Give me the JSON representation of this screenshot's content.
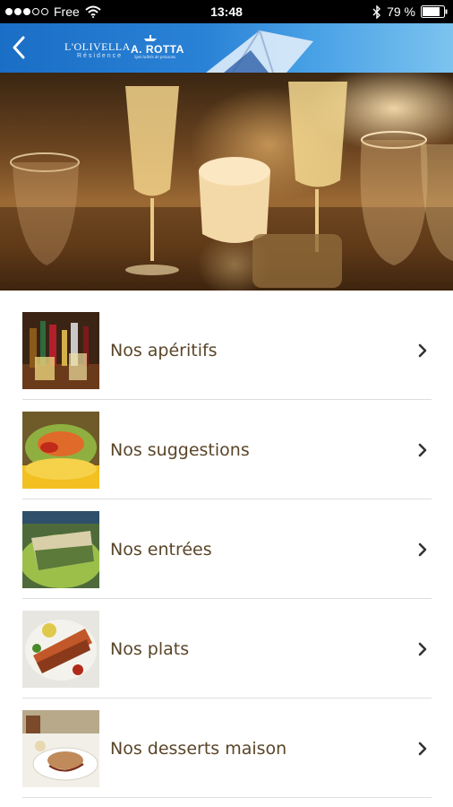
{
  "status_bar": {
    "carrier": "Free",
    "time": "13:48",
    "battery": "79 %",
    "icons": [
      "signal-dots",
      "wifi-icon",
      "bluetooth-icon",
      "battery-icon"
    ]
  },
  "navbar": {
    "back_icon": "chevron-left-icon",
    "logo_left_title": "L'OLIVELLA",
    "logo_left_sub": "Résidence",
    "logo_right_title": "A. ROTTA",
    "logo_right_sub": "Spécialités de poissons",
    "background_colors": [
      "#1a6ec5",
      "#7cc3ef"
    ]
  },
  "menu": {
    "text_color": "#5a4528",
    "chevron_icon": "chevron-right-icon",
    "items": [
      {
        "label": "Nos apéritifs",
        "thumb": "aperitifs-photo"
      },
      {
        "label": "Nos suggestions",
        "thumb": "suggestions-photo"
      },
      {
        "label": "Nos entrées",
        "thumb": "entrees-photo"
      },
      {
        "label": "Nos plats",
        "thumb": "plats-photo"
      },
      {
        "label": "Nos desserts maison",
        "thumb": "desserts-photo"
      }
    ]
  }
}
